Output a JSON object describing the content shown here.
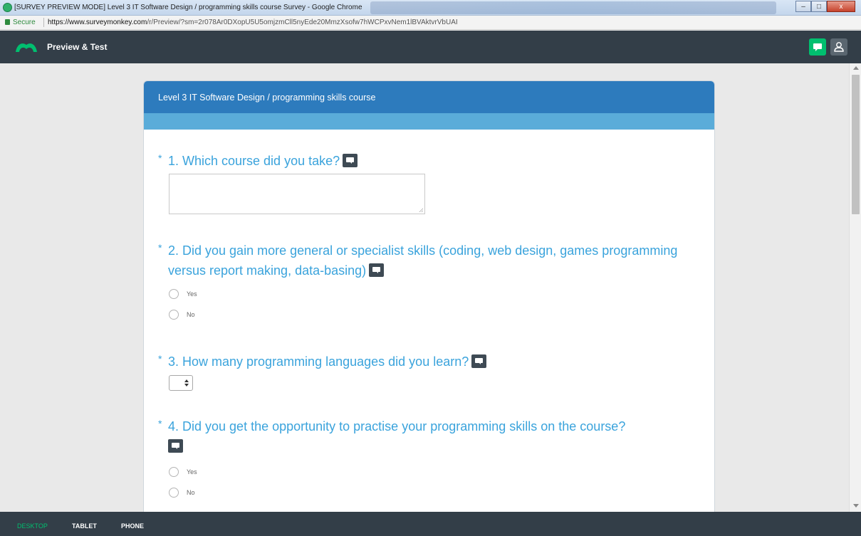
{
  "window": {
    "title": "[SURVEY PREVIEW MODE] Level 3 IT Software Design / programming skills course Survey - Google Chrome",
    "minimize": "–",
    "maximize": "□",
    "close": "x"
  },
  "address": {
    "secure": "Secure",
    "url_host": "https://www.surveymonkey.com",
    "url_path": "/r/Preview/?sm=2r078Ar0DXopU5U5omjzmCll5nyEde20MmzXsofw7hWCPxvNem1lBVAktvrVbUAI"
  },
  "header": {
    "title": "Preview & Test",
    "icons": [
      "comment-icon",
      "user-icon"
    ],
    "accent": "#00bf6f"
  },
  "survey": {
    "title": "Level 3 IT Software Design / programming skills course",
    "required_marker": "*",
    "q1": {
      "text": "1. Which course did you take?"
    },
    "q2": {
      "text": "2. Did you gain more general or specialist skills (coding, web design, games programming versus report making, data-basing)",
      "options": [
        "Yes",
        "No"
      ]
    },
    "q3": {
      "text": "3. How many programming languages did you learn?"
    },
    "q4": {
      "text": "4. Did you get the opportunity to practise your programming skills on the course?",
      "options": [
        "Yes",
        "No"
      ]
    }
  },
  "footer": {
    "devices": [
      "DESKTOP",
      "TABLET",
      "PHONE"
    ],
    "active": "DESKTOP"
  },
  "colors": {
    "header_bg": "#333e48",
    "survey_header": "#2d7bbd",
    "question_text": "#3aa3dc"
  }
}
